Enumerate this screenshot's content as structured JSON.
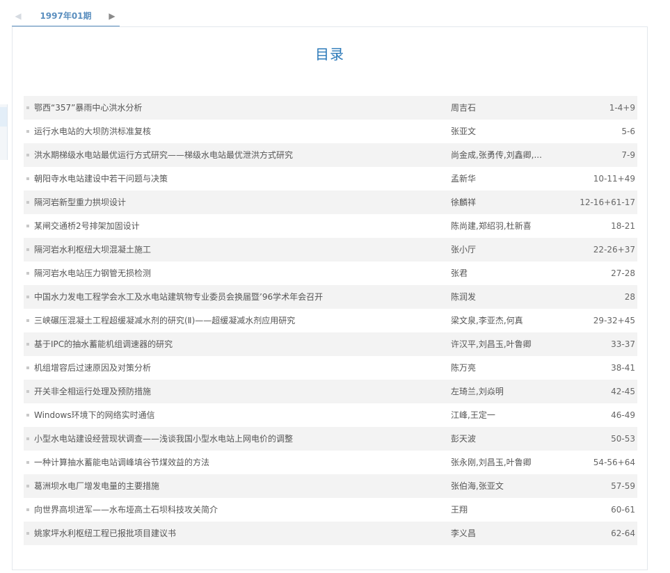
{
  "issue_nav": {
    "prev_icon": "triangle-left-icon",
    "next_icon": "triangle-right-icon",
    "current_issue": "1997年01期"
  },
  "panel": {
    "title": "目录"
  },
  "articles": [
    {
      "title": "鄂西“357”暴雨中心洪水分析",
      "authors": "周吉石",
      "pages": "1-4+9"
    },
    {
      "title": "运行水电站的大坝防洪标准复核",
      "authors": "张亚文",
      "pages": "5-6"
    },
    {
      "title": "洪水期梯级水电站最优运行方式研究——梯级水电站最优泄洪方式研究",
      "authors": "尚金成,张勇传,刘鑫卿,...",
      "pages": "7-9"
    },
    {
      "title": "朝阳寺水电站建设中若干问题与决策",
      "authors": "孟新华",
      "pages": "10-11+49"
    },
    {
      "title": "隔河岩新型重力拱坝设计",
      "authors": "徐麟祥",
      "pages": "12-16+61-17"
    },
    {
      "title": "某闸交通桥2号排架加固设计",
      "authors": "陈尚建,郑绍羽,杜新喜",
      "pages": "18-21"
    },
    {
      "title": "隔河岩水利枢纽大坝混凝土施工",
      "authors": "张小厅",
      "pages": "22-26+37"
    },
    {
      "title": "隔河岩水电站压力钢管无损检测",
      "authors": "张君",
      "pages": "27-28"
    },
    {
      "title": "中国水力发电工程学会水工及水电站建筑物专业委员会换届暨’96学术年会召开",
      "authors": "陈润发",
      "pages": "28"
    },
    {
      "title": "三峡碾压混凝土工程超缓凝减水剂的研究(Ⅱ)——超缓凝减水剂应用研究",
      "authors": "梁文泉,李亚杰,何真",
      "pages": "29-32+45"
    },
    {
      "title": "基于IPC的抽水蓄能机组调速器的研究",
      "authors": "许汉平,刘昌玉,叶鲁卿",
      "pages": "33-37"
    },
    {
      "title": "机组增容后过速原因及对策分析",
      "authors": "陈万亮",
      "pages": "38-41"
    },
    {
      "title": "开关非全相运行处理及预防措施",
      "authors": "左琦兰,刘焱明",
      "pages": "42-45"
    },
    {
      "title": "Windows环境下的网络实时通信",
      "authors": "江峰,王定一",
      "pages": "46-49"
    },
    {
      "title": "小型水电站建设经营现状调查——浅谈我国小型水电站上网电价的调整",
      "authors": "彭天波",
      "pages": "50-53"
    },
    {
      "title": "一种计算抽水蓄能电站调峰填谷节煤效益的方法",
      "authors": "张永刚,刘昌玉,叶鲁卿",
      "pages": "54-56+64"
    },
    {
      "title": "葛洲坝水电厂增发电量的主要措施",
      "authors": "张伯海,张亚文",
      "pages": "57-59"
    },
    {
      "title": "向世界高坝进军——水布垭高土石坝科技攻关简介",
      "authors": "王翔",
      "pages": "60-61"
    },
    {
      "title": "姚家坪水利枢纽工程已报批项目建议书",
      "authors": "李义昌",
      "pages": "62-64"
    }
  ]
}
